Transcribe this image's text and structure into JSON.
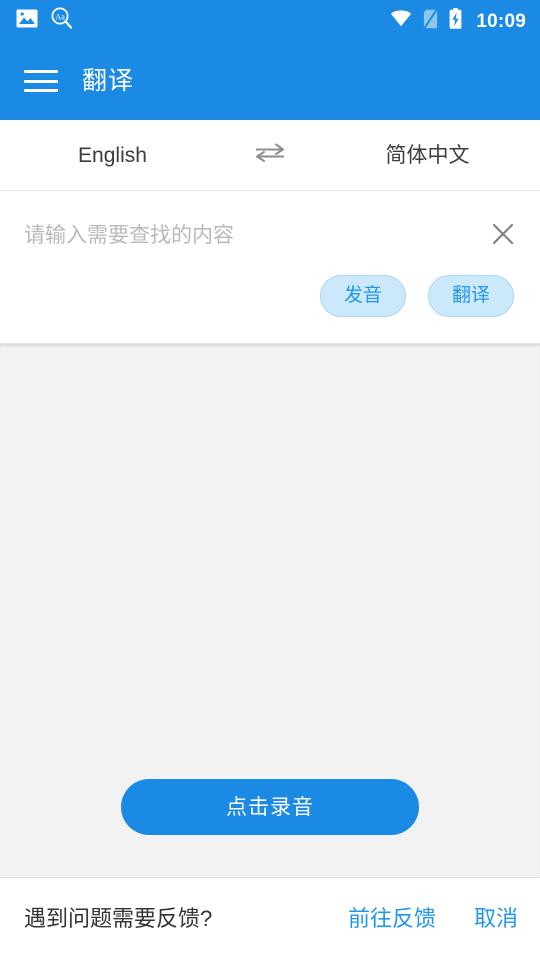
{
  "status_bar": {
    "icons": [
      "gallery-icon",
      "text-search-icon",
      "wifi-icon",
      "no-sim-icon",
      "battery-charging-icon"
    ],
    "time": "10:09"
  },
  "app_bar": {
    "menu_icon": "hamburger-menu-icon",
    "title": "翻译"
  },
  "language_bar": {
    "source_language": "English",
    "swap_icon": "swap-horizontal-icon",
    "target_language": "简体中文"
  },
  "input_section": {
    "placeholder": "请输入需要查找的内容",
    "value": "",
    "clear_icon": "close-icon",
    "buttons": [
      {
        "label": "发音",
        "name": "pronounce-button"
      },
      {
        "label": "翻译",
        "name": "translate-button"
      }
    ]
  },
  "content": {
    "result_text": "",
    "record_button_label": "点击录音"
  },
  "bottom_bar": {
    "prompt": "遇到问题需要反馈?",
    "feedback_link": "前往反馈",
    "cancel_link": "取消"
  },
  "colors": {
    "primary_blue": "#1A8AE5",
    "accent_link": "#2196F3",
    "pill_fill": "#CCE9FC",
    "content_bg": "#F2F2F2",
    "text_dark": "#333333",
    "placeholder": "#b9b9b9"
  }
}
